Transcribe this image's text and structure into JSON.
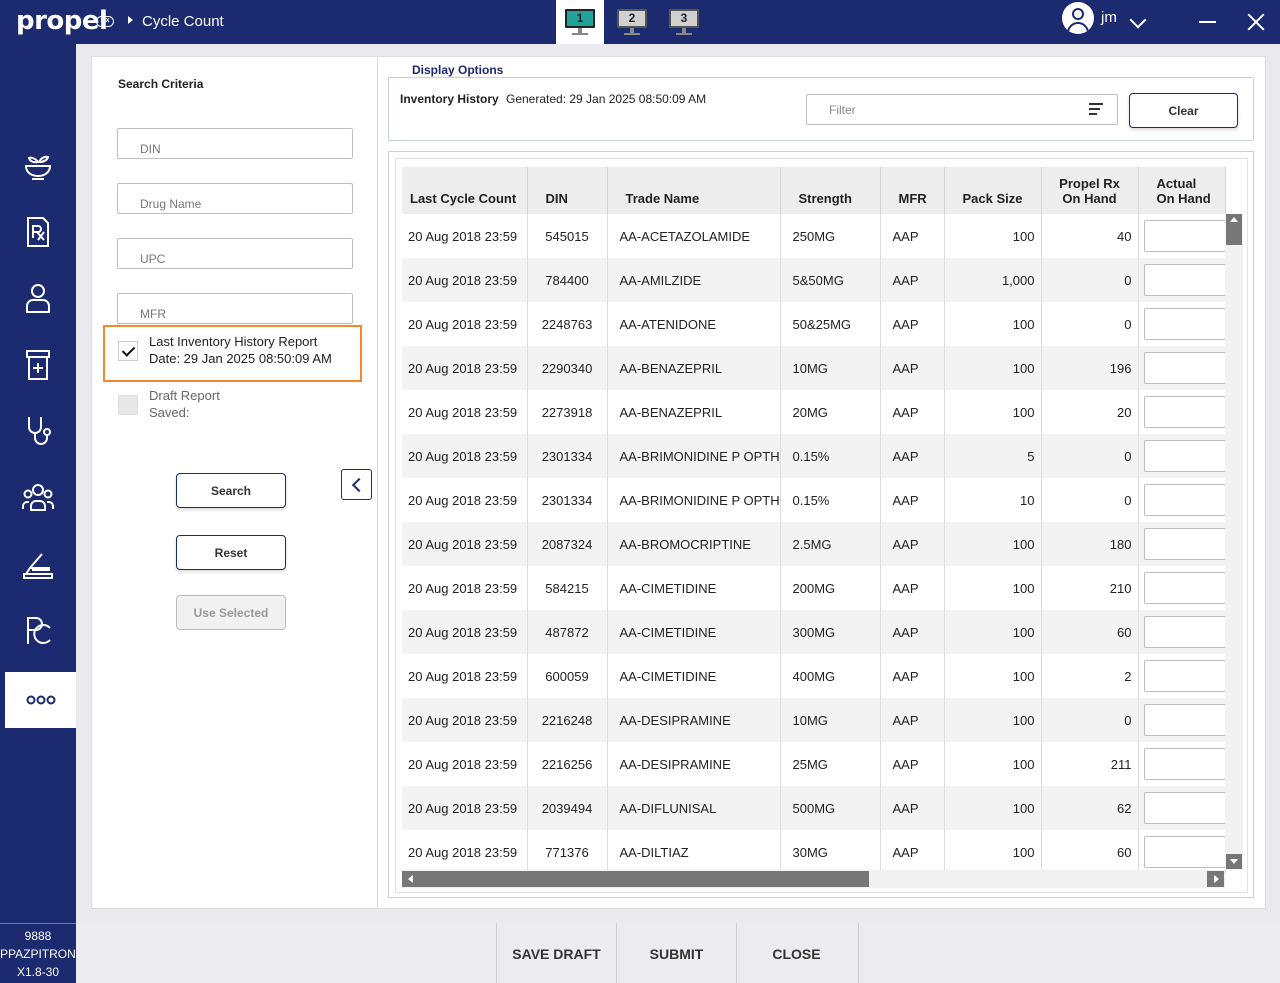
{
  "app": {
    "logo": "propel",
    "logo_badge": "Rx",
    "breadcrumb": "Cycle Count"
  },
  "screens": [
    {
      "label": "1",
      "active": true
    },
    {
      "label": "2",
      "active": false
    },
    {
      "label": "3",
      "active": false
    }
  ],
  "user": {
    "name": "jm"
  },
  "station": {
    "line1": "9888",
    "line2": "PPAZPITRON02",
    "line3": "X1.8-30"
  },
  "search": {
    "title": "Search Criteria",
    "din_placeholder": "DIN",
    "drug_name_placeholder": "Drug Name",
    "upc_placeholder": "UPC",
    "mfr_placeholder": "MFR",
    "last_report_label": "Last Inventory History Report",
    "last_report_date": "Date:  29 Jan 2025 08:50:09 AM",
    "draft_label": "Draft Report",
    "draft_saved": "Saved:",
    "search_btn": "Search",
    "reset_btn": "Reset",
    "use_selected_btn": "Use Selected"
  },
  "display": {
    "legend": "Display Options",
    "report_title": "Inventory History",
    "generated": "Generated: 29 Jan 2025 08:50:09 AM",
    "filter_placeholder": "Filter",
    "clear_btn": "Clear"
  },
  "table": {
    "headers": {
      "last_cycle": "Last Cycle Count",
      "din": "DIN",
      "trade": "Trade Name",
      "strength": "Strength",
      "mfr": "MFR",
      "pack": "Pack Size",
      "onhand_1": "Propel Rx",
      "onhand_2": "On Hand",
      "actual_1": "Actual",
      "actual_2": "On Hand"
    },
    "rows": [
      {
        "date": "20 Aug 2018 23:59",
        "din": "545015",
        "trade": "AA-ACETAZOLAMIDE",
        "strength": "250MG",
        "mfr": "AAP",
        "pack": "100",
        "onhand": "40"
      },
      {
        "date": "20 Aug 2018 23:59",
        "din": "784400",
        "trade": "AA-AMILZIDE",
        "strength": "5&50MG",
        "mfr": "AAP",
        "pack": "1,000",
        "onhand": "0"
      },
      {
        "date": "20 Aug 2018 23:59",
        "din": "2248763",
        "trade": "AA-ATENIDONE",
        "strength": "50&25MG",
        "mfr": "AAP",
        "pack": "100",
        "onhand": "0"
      },
      {
        "date": "20 Aug 2018 23:59",
        "din": "2290340",
        "trade": "AA-BENAZEPRIL",
        "strength": "10MG",
        "mfr": "AAP",
        "pack": "100",
        "onhand": "196"
      },
      {
        "date": "20 Aug 2018 23:59",
        "din": "2273918",
        "trade": "AA-BENAZEPRIL",
        "strength": "20MG",
        "mfr": "AAP",
        "pack": "100",
        "onhand": "20"
      },
      {
        "date": "20 Aug 2018 23:59",
        "din": "2301334",
        "trade": "AA-BRIMONIDINE P OPTH",
        "strength": "0.15%",
        "mfr": "AAP",
        "pack": "5",
        "onhand": "0"
      },
      {
        "date": "20 Aug 2018 23:59",
        "din": "2301334",
        "trade": "AA-BRIMONIDINE P OPTH",
        "strength": "0.15%",
        "mfr": "AAP",
        "pack": "10",
        "onhand": "0"
      },
      {
        "date": "20 Aug 2018 23:59",
        "din": "2087324",
        "trade": "AA-BROMOCRIPTINE",
        "strength": "2.5MG",
        "mfr": "AAP",
        "pack": "100",
        "onhand": "180"
      },
      {
        "date": "20 Aug 2018 23:59",
        "din": "584215",
        "trade": "AA-CIMETIDINE",
        "strength": "200MG",
        "mfr": "AAP",
        "pack": "100",
        "onhand": "210"
      },
      {
        "date": "20 Aug 2018 23:59",
        "din": "487872",
        "trade": "AA-CIMETIDINE",
        "strength": "300MG",
        "mfr": "AAP",
        "pack": "100",
        "onhand": "60"
      },
      {
        "date": "20 Aug 2018 23:59",
        "din": "600059",
        "trade": "AA-CIMETIDINE",
        "strength": "400MG",
        "mfr": "AAP",
        "pack": "100",
        "onhand": "2"
      },
      {
        "date": "20 Aug 2018 23:59",
        "din": "2216248",
        "trade": "AA-DESIPRAMINE",
        "strength": "10MG",
        "mfr": "AAP",
        "pack": "100",
        "onhand": "0"
      },
      {
        "date": "20 Aug 2018 23:59",
        "din": "2216256",
        "trade": "AA-DESIPRAMINE",
        "strength": "25MG",
        "mfr": "AAP",
        "pack": "100",
        "onhand": "211"
      },
      {
        "date": "20 Aug 2018 23:59",
        "din": "2039494",
        "trade": "AA-DIFLUNISAL",
        "strength": "500MG",
        "mfr": "AAP",
        "pack": "100",
        "onhand": "62"
      },
      {
        "date": "20 Aug 2018 23:59",
        "din": "771376",
        "trade": "AA-DILTIAZ",
        "strength": "30MG",
        "mfr": "AAP",
        "pack": "100",
        "onhand": "60"
      }
    ]
  },
  "footer": {
    "save_draft": "SAVE DRAFT",
    "submit": "SUBMIT",
    "close": "CLOSE"
  },
  "colors": {
    "nav": "#1c2a6f",
    "accent": "#1fa39a",
    "highlight": "#f08a2c"
  },
  "icons": [
    "mortar-pestle-icon",
    "prescription-icon",
    "patient-icon",
    "pill-bottle-icon",
    "stethoscope-icon",
    "group-icon",
    "scale-icon",
    "pc-logo-icon",
    "more-icon"
  ]
}
